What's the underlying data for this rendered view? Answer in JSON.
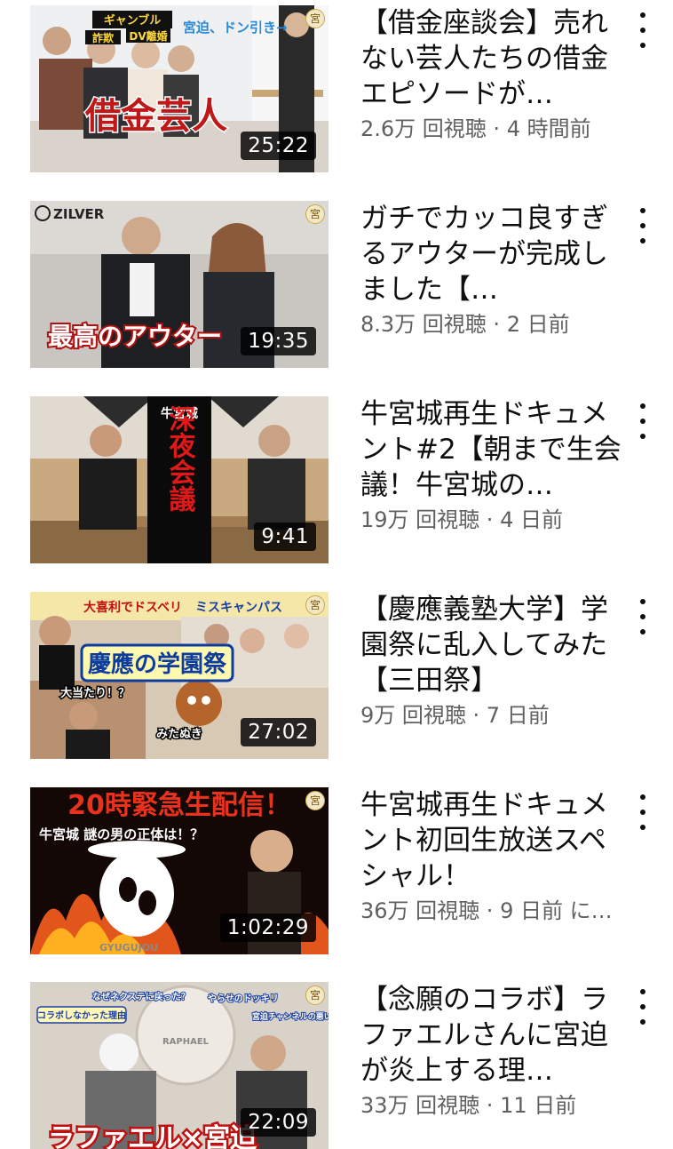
{
  "videos": [
    {
      "title": "【借金座談会】売れない芸人たちの借金エピソードが…",
      "views": "2.6万 回視聴",
      "age": "4 時間前",
      "duration": "25:22",
      "thumb_text": [
        "借金芸人",
        "ギャンブル",
        "詐欺",
        "DV離婚",
        "宮迫、ドン引き→"
      ]
    },
    {
      "title": "ガチでカッコ良すぎるアウターが完成しました【…",
      "views": "8.3万 回視聴",
      "age": "2 日前",
      "duration": "19:35",
      "thumb_text": [
        "最高のアウター",
        "ZILVER"
      ]
    },
    {
      "title": "牛宮城再生ドキュメント#2【朝まで生会議！牛宮城の…",
      "views": "19万 回視聴",
      "age": "4 日前",
      "duration": "9:41",
      "thumb_text": [
        "牛宮城",
        "深夜会議"
      ]
    },
    {
      "title": "【慶應義塾大学】学園祭に乱入してみた【三田祭】",
      "views": "9万 回視聴",
      "age": "7 日前",
      "duration": "27:02",
      "thumb_text": [
        "慶應の学園祭",
        "大喜利でドスベリ",
        "ミスキャンパス",
        "大当たり！？",
        "みたぬき"
      ]
    },
    {
      "title": "牛宮城再生ドキュメント初回生放送スペシャル！",
      "views": "36万 回視聴",
      "age": "9 日前 に…",
      "duration": "1:02:29",
      "thumb_text": [
        "20時緊急生配信！",
        "牛宮城 謎の男の正体は！？",
        "GYUGUJOU"
      ]
    },
    {
      "title": "【念願のコラボ】ラファエルさんに宮迫が炎上する理…",
      "views": "33万 回視聴",
      "age": "11 日前",
      "duration": "22:09",
      "thumb_text": [
        "ラファエル×宮迫",
        "コラボしなかった理由",
        "なぜネクステに戻った？",
        "やらせのドッキリ",
        "宮迫チャンネルの悪い所",
        "RAPHAEL"
      ]
    }
  ],
  "channel_badge": "宮",
  "meta_separator": " · ",
  "menu_icon": "more-vertical-icon",
  "colors": {
    "title": "#0f0f0f",
    "meta": "#606060",
    "duration_bg": "#000000"
  }
}
